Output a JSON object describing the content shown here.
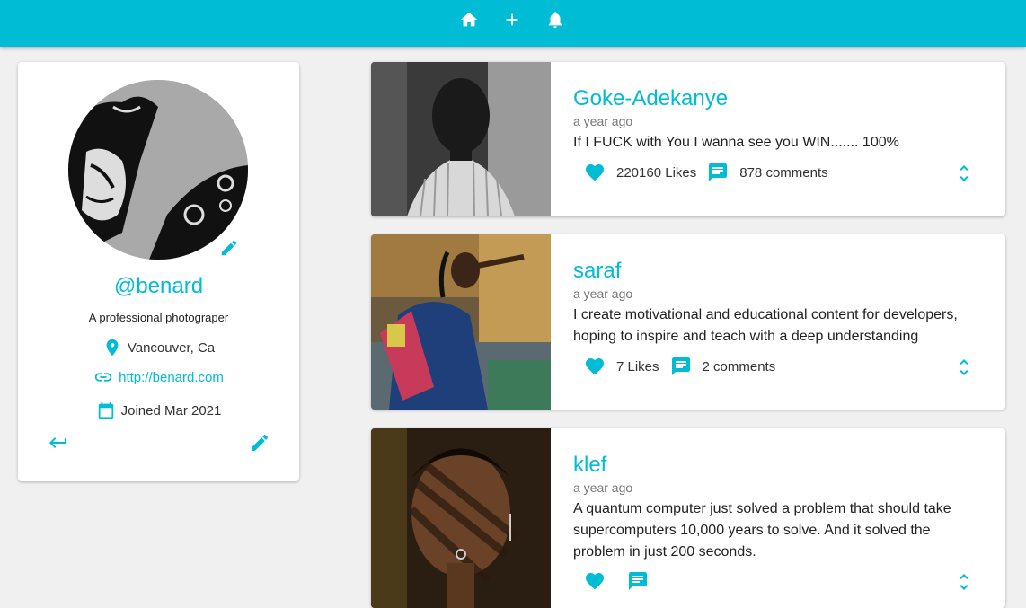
{
  "nav": {
    "home_icon": "home-icon",
    "add_icon": "plus-icon",
    "notifications_icon": "bell-icon"
  },
  "colors": {
    "accent": "#00bcd4",
    "background": "#f0f0f0"
  },
  "profile": {
    "handle": "@benard",
    "bio": "A professional photograper",
    "location": "Vancouver, Ca",
    "website": "http://benard.com",
    "joined": "Joined Mar 2021"
  },
  "posts": [
    {
      "author": "Goke-Adekanye",
      "time": "a year ago",
      "body": "If I FUCK with You I wanna see you WIN....... 100%",
      "likes": "220160 Likes",
      "comments": "878 comments"
    },
    {
      "author": "saraf",
      "time": "a year ago",
      "body": "I create motivational and educational content for developers, hoping to inspire and teach with a deep understanding",
      "likes": "7 Likes",
      "comments": "2 comments"
    },
    {
      "author": "klef",
      "time": "a year ago",
      "body": "A quantum computer just solved a problem that should take supercomputers 10,000 years to solve. And it solved the problem in just 200 seconds.",
      "likes": "",
      "comments": ""
    }
  ]
}
